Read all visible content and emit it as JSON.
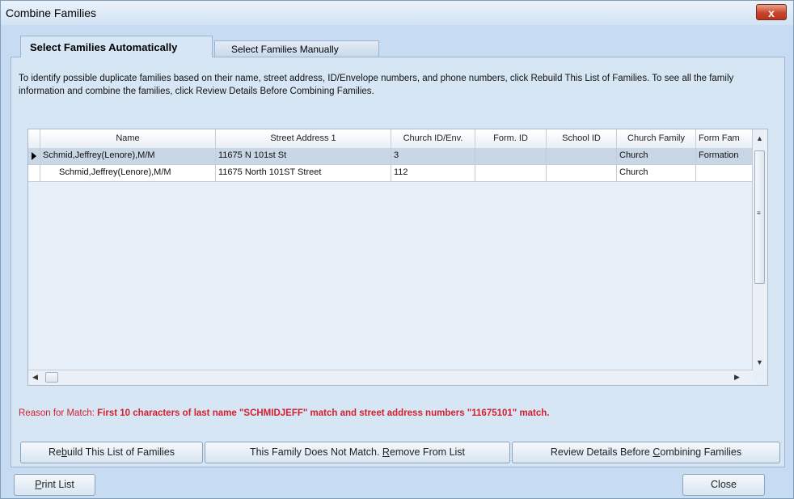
{
  "window": {
    "title": "Combine Families",
    "close_glyph": "x"
  },
  "tabs": [
    {
      "label": "Select Families Automatically",
      "active": true
    },
    {
      "label": "Select Families Manually",
      "active": false
    }
  ],
  "description": "To identify possible duplicate families based on their name, street address, ID/Envelope numbers, and phone numbers, click Rebuild This List of Families. To see all the family information and combine the families, click Review Details Before Combining Families.",
  "grid": {
    "columns": [
      "Name",
      "Street Address 1",
      "Church ID/Env.",
      "Form. ID",
      "School ID",
      "Church Family",
      "Form Fam"
    ],
    "rows": [
      {
        "selected": true,
        "cells": [
          "Schmid,Jeffrey(Lenore),M/M",
          "11675 N 101st St",
          "3",
          "",
          "",
          "Church",
          "Formation"
        ]
      },
      {
        "selected": false,
        "cells": [
          "Schmid,Jeffrey(Lenore),M/M",
          "11675 North 101ST Street",
          "112",
          "",
          "",
          "Church",
          ""
        ]
      }
    ]
  },
  "reason": {
    "label": "Reason for Match:",
    "text": "First 10 characters of last name \"SCHMIDJEFF\" match and street address numbers \"11675101\" match."
  },
  "buttons": {
    "rebuild": {
      "pre": "Re",
      "key": "b",
      "post": "uild This List of Families"
    },
    "remove": {
      "pre": "This Family Does Not Match. ",
      "key": "R",
      "post": "emove From List"
    },
    "review": {
      "pre": "Review Details Before ",
      "key": "C",
      "post": "ombining Families"
    },
    "print": {
      "pre": "",
      "key": "P",
      "post": "rint List"
    },
    "close": {
      "label": "Close"
    }
  }
}
